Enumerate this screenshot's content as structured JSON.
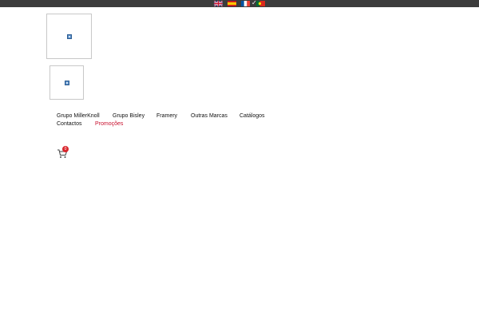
{
  "language_bar": {
    "languages": [
      {
        "name": "English",
        "flag": "uk-flag-icon"
      },
      {
        "name": "Español",
        "flag": "spain-flag-icon"
      },
      {
        "name": "Français",
        "flag": "france-flag-icon"
      },
      {
        "name": "Português",
        "flag": "portugal-flag-icon",
        "selected": true
      }
    ],
    "selected_mark": "✓",
    "colors": {
      "bar": "#3c3c3c"
    }
  },
  "nav": {
    "items_row1": [
      "Grupo MillerKnoll",
      "Grupo Bisley",
      "Framery",
      "Outras Marcas",
      "Catálogos"
    ],
    "items_row2": [
      "Contactos",
      "Promoções"
    ],
    "active_item": "Promoções",
    "colors": {
      "text": "#111111",
      "active": "#c8102e"
    }
  },
  "cart": {
    "icon": "shopping-cart-icon",
    "count": "0",
    "colors": {
      "badge": "#d9262c"
    }
  }
}
